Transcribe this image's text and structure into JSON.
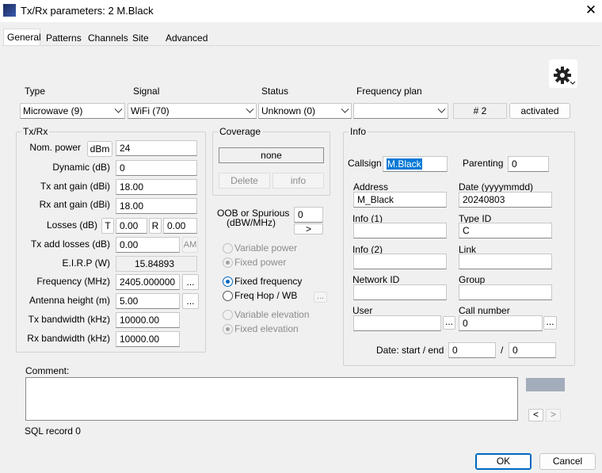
{
  "window": {
    "title": "Tx/Rx parameters: 2 M.Black",
    "close": "✕"
  },
  "tabs": [
    "General",
    "Patterns",
    "Channels",
    "Site",
    "Advanced"
  ],
  "top": {
    "type_label": "Type",
    "type_value": "Microwave (9)",
    "signal_label": "Signal",
    "signal_value": "WiFi (70)",
    "status_label": "Status",
    "status_value": "Unknown (0)",
    "freqplan_label": "Frequency plan",
    "freqplan_value": "",
    "record_number": "# 2",
    "activated_button": "activated"
  },
  "txrx": {
    "group_label": "Tx/Rx",
    "nom_power_label": "Nom. power",
    "nom_power_unit": "dBm",
    "nom_power": "24",
    "dynamic_label": "Dynamic (dB)",
    "dynamic": "0",
    "tx_gain_label": "Tx ant gain (dBi)",
    "tx_gain": "18.00",
    "rx_gain_label": "Rx ant gain (dBi)",
    "rx_gain": "18.00",
    "losses_label": "Losses (dB)",
    "losses_t_label": "T",
    "losses_t": "0.00",
    "losses_r_label": "R",
    "losses_r": "0.00",
    "tx_add_losses_label": "Tx add losses (dB)",
    "tx_add_losses": "0.00",
    "am_button": "AM",
    "eirp_label": "E.I.R.P (W)",
    "eirp": "15.84893",
    "frequency_label": "Frequency (MHz)",
    "frequency": "2405.000000",
    "antenna_height_label": "Antenna height (m)",
    "antenna_height": "5.00",
    "tx_bw_label": "Tx bandwidth (kHz)",
    "tx_bw": "10000.00",
    "rx_bw_label": "Rx bandwidth (kHz)",
    "rx_bw": "10000.00",
    "ellipsis": "..."
  },
  "coverage": {
    "group_label": "Coverage",
    "value": "none",
    "delete_button": "Delete",
    "info_button": "info",
    "oob_label_1": "OOB or Spurious",
    "oob_label_2": "(dBW/MHz)",
    "oob_value": "0",
    "oob_button": ">",
    "variable_power": "Variable power",
    "fixed_power": "Fixed power",
    "fixed_frequency": "Fixed frequency",
    "freq_hop": "Freq Hop / WB",
    "freq_hop_button": "...",
    "variable_elevation": "Variable elevation",
    "fixed_elevation": "Fixed elevation"
  },
  "info": {
    "group_label": "Info",
    "callsign_label": "Callsign",
    "callsign": "M.Black",
    "parenting_label": "Parenting",
    "parenting": "0",
    "address_label": "Address",
    "address": "M_Black",
    "date_label": "Date (yyyymmdd)",
    "date": "20240803",
    "info1_label": "Info (1)",
    "info1": "",
    "type_id_label": "Type ID",
    "type_id": "C",
    "info2_label": "Info (2)",
    "info2": "",
    "link_label": "Link",
    "link": "",
    "network_id_label": "Network ID",
    "network_id": "",
    "group_field_label": "Group",
    "group_value": "",
    "user_label": "User",
    "user": "",
    "call_number_label": "Call number",
    "call_number": "0",
    "date_range_label": "Date: start / end",
    "date_start": "0",
    "date_sep": "/",
    "date_end": "0",
    "ellipsis": "..."
  },
  "comment": {
    "label": "Comment:",
    "value": "",
    "prev": "<",
    "next": ">"
  },
  "sql_record": "SQL record 0",
  "footer": {
    "ok": "OK",
    "cancel": "Cancel"
  },
  "colors": {
    "accent": "#0067c0",
    "swatch": "#a3acba",
    "selection": "#0078d7"
  }
}
